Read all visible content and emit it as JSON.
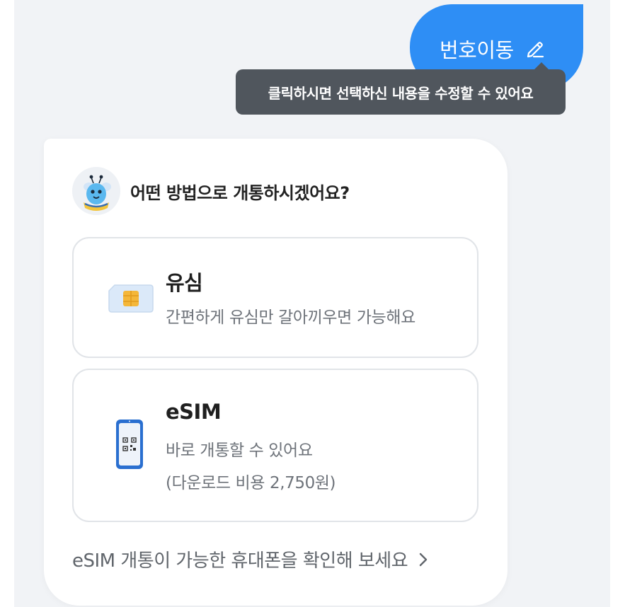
{
  "user_message": {
    "label": "번호이동",
    "icon": "edit-pencil-icon",
    "bubble_color": "#2e8ef5"
  },
  "tooltip": {
    "text": "클릭하시면 선택하신 내용을 수정할 수 있어요",
    "background": "#50565d"
  },
  "bot": {
    "avatar": "bee-mascot-avatar",
    "question": "어떤 방법으로 개통하시겠어요?",
    "options": [
      {
        "icon": "usim-card-icon",
        "title": "유심",
        "description": "간편하게 유심만 갈아끼우면 가능해요"
      },
      {
        "icon": "esim-phone-qr-icon",
        "title": "eSIM",
        "description": "바로 개통할 수 있어요",
        "note": "(다운로드 비용 2,750원)"
      }
    ],
    "link": {
      "label": "eSIM 개통이 가능한 휴대폰을 확인해 보세요",
      "icon": "chevron-right-icon"
    }
  }
}
